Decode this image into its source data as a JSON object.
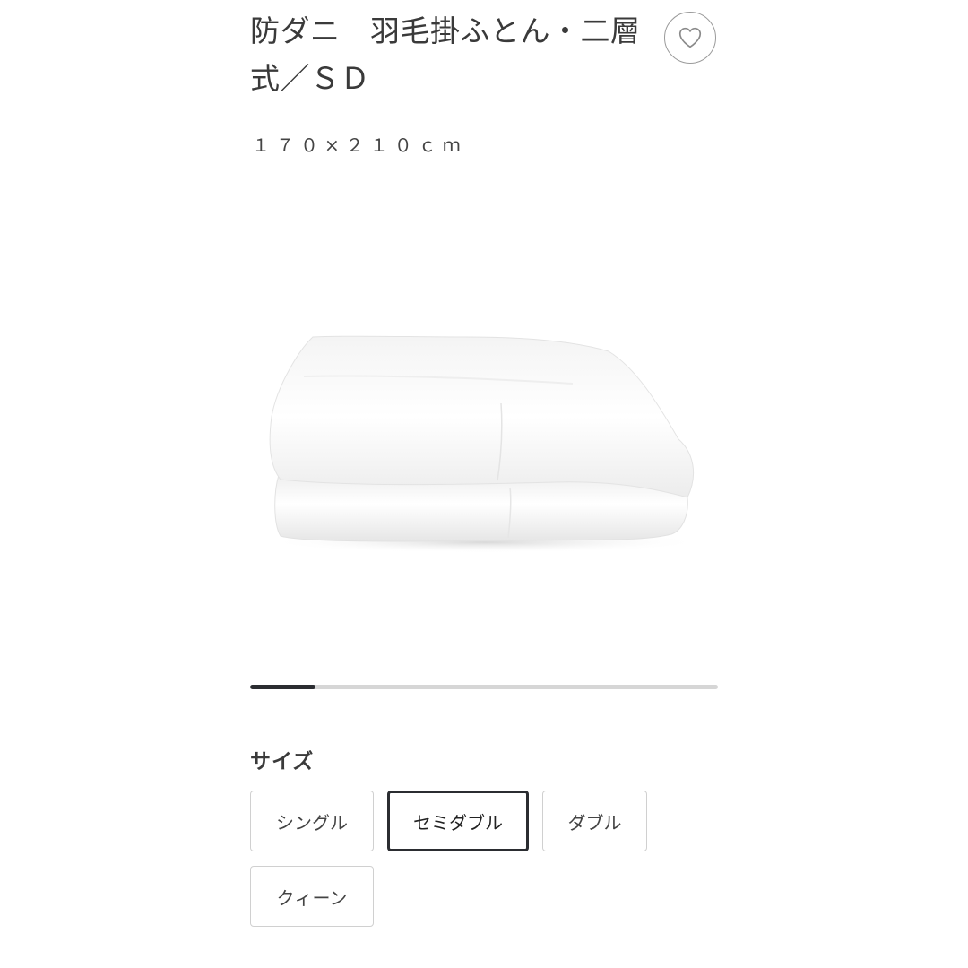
{
  "product": {
    "title": "防ダニ　羽毛掛ふとん・二層式／ＳＤ",
    "dimensions": "１７０×２１０ｃｍ",
    "favorite_icon": "heart-outline-icon",
    "image_subject": "folded white duvet"
  },
  "carousel": {
    "progress_fraction": 0.14
  },
  "size_selector": {
    "heading": "サイズ",
    "options": [
      {
        "label": "シングル",
        "selected": false
      },
      {
        "label": "セミダブル",
        "selected": true
      },
      {
        "label": "ダブル",
        "selected": false
      },
      {
        "label": "クィーン",
        "selected": false
      }
    ]
  },
  "colors": {
    "accent_dark": "#2b2d31",
    "track_gray": "#d6d6d6",
    "border_gray": "#d0d0d0"
  }
}
